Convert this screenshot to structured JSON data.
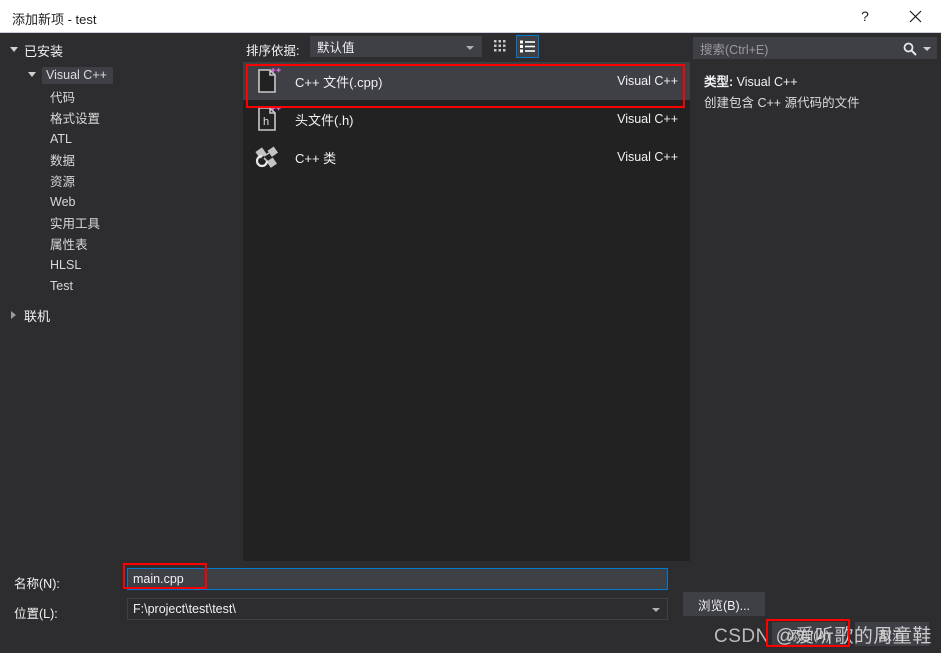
{
  "window": {
    "title": "添加新项 - test",
    "help_label": "?",
    "close_label": "×"
  },
  "sidebar": {
    "installed": {
      "label": "已安装",
      "expanded": true
    },
    "category": {
      "label": "Visual C++",
      "expanded": true,
      "selected": true
    },
    "items": [
      {
        "label": "代码"
      },
      {
        "label": "格式设置"
      },
      {
        "label": "ATL"
      },
      {
        "label": "数据"
      },
      {
        "label": "资源"
      },
      {
        "label": "Web"
      },
      {
        "label": "实用工具"
      },
      {
        "label": "属性表"
      },
      {
        "label": "HLSL"
      },
      {
        "label": "Test"
      }
    ],
    "online": {
      "label": "联机",
      "expanded": false
    }
  },
  "toolbar": {
    "sort_label": "排序依据:",
    "sort_value": "默认值",
    "view_tiles_name": "tiles-view",
    "view_list_name": "list-view",
    "view_list_selected": true
  },
  "list": {
    "items": [
      {
        "name": "C++ 文件(.cpp)",
        "category": "Visual C++",
        "icon": "cpp-file-icon",
        "selected": true
      },
      {
        "name": "头文件(.h)",
        "category": "Visual C++",
        "icon": "header-file-icon",
        "selected": false
      },
      {
        "name": "C++ 类",
        "category": "Visual C++",
        "icon": "cpp-class-icon",
        "selected": false
      }
    ]
  },
  "search": {
    "placeholder": "搜索(Ctrl+E)",
    "value": ""
  },
  "details": {
    "type_key": "类型:",
    "type_value": "Visual C++",
    "description": "创建包含 C++ 源代码的文件"
  },
  "bottom": {
    "name_label": "名称(N):",
    "name_value": "main.cpp",
    "location_label": "位置(L):",
    "location_value": "F:\\project\\test\\test\\",
    "browse_label": "浏览(B)...",
    "add_label": "添加(A)",
    "cancel_label": "取消"
  },
  "watermark": {
    "prefix": "CSDN",
    "handle": "@爱听歌的周童鞋"
  },
  "colors": {
    "dialog_bg": "#2d2d30",
    "list_bg": "#222222",
    "selection_bg": "#3f3f46",
    "accent_blue": "#007acc",
    "annotation_red": "#ff0000",
    "titlebar_bg": "#ffffff",
    "text": "#f1f1f1"
  }
}
